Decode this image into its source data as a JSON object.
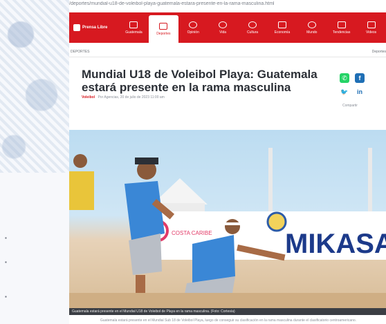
{
  "url_bar": "/deportes/mundial-u18-de-voleibol-playa-guatemala-estara-presente-en-la-rama-masculina.html",
  "brand": {
    "name": "Prensa Libre"
  },
  "nav": {
    "items": [
      {
        "label": "Guatemala",
        "icon": "flag-icon"
      },
      {
        "label": "Deportes",
        "icon": "sport-icon",
        "active": true
      },
      {
        "label": "Opinión",
        "icon": "chat-icon"
      },
      {
        "label": "Vida",
        "icon": "leaf-icon"
      },
      {
        "label": "Cultura",
        "icon": "globe-icon"
      },
      {
        "label": "Economía",
        "icon": "chart-icon"
      },
      {
        "label": "Mundo",
        "icon": "world-icon"
      },
      {
        "label": "Tendencias",
        "icon": "trend-icon"
      },
      {
        "label": "Videos",
        "icon": "video-icon"
      }
    ]
  },
  "breadcrumb": {
    "section": "DEPORTES",
    "right": "Deportes"
  },
  "article": {
    "title": "Mundial U18 de Voleibol Playa: Guatemala estará presente en la rama masculina",
    "byline_tag": "Voleibol",
    "byline": "Por Agencias, 20 de julio de 2023 11:00 am",
    "share_label": "Compartir",
    "caption": "Guatemala estará presente en el Mundial U18 de Voleibol de Playa en la rama masculina. (Foto: Cortesía)",
    "footnote": "Guatemala estará presente en el Mundial Sub 18 de Voleibol Playa, luego de conseguir su clasificación en la rama masculina durante el clasificatorio centroamericano."
  },
  "photo": {
    "banner_text": "MIKASA",
    "banner_sponsor": "COSTA CARIBE"
  },
  "colors": {
    "brand_red": "#d71920",
    "sky": "#bcdcf1",
    "sand": "#d8bd98"
  }
}
